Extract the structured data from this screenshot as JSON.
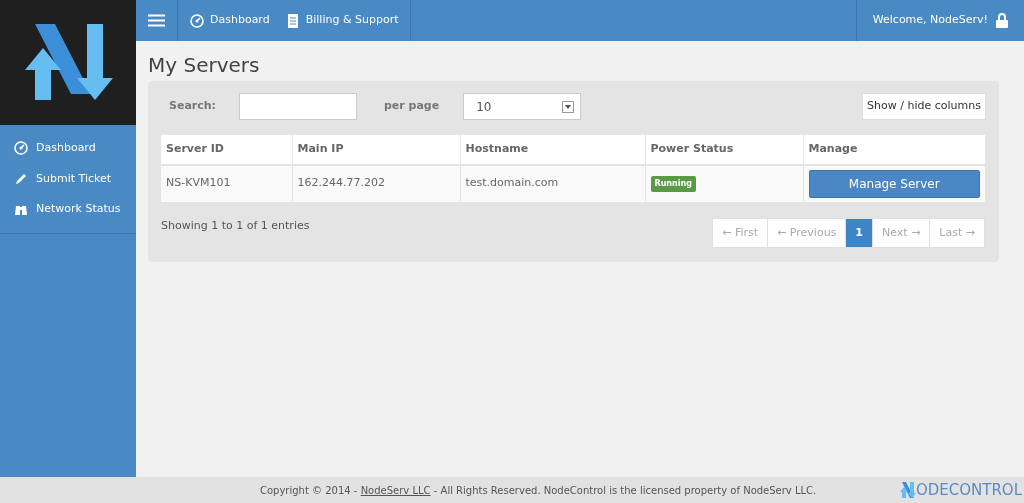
{
  "topbar": {
    "items": [
      {
        "label": "Dashboard"
      },
      {
        "label": "Billing & Support"
      }
    ],
    "welcome": "Welcome, NodeServ!"
  },
  "sidebar": {
    "items": [
      {
        "label": "Dashboard"
      },
      {
        "label": "Submit Ticket"
      },
      {
        "label": "Network Status"
      }
    ]
  },
  "page_title": "My Servers",
  "search": {
    "label": "Search:"
  },
  "per_page": {
    "label": "per page",
    "value": "10"
  },
  "columns_button": "Show / hide columns",
  "table": {
    "columns": [
      "Server ID",
      "Main IP",
      "Hostname",
      "Power Status",
      "Manage"
    ],
    "rows": [
      {
        "server_id": "NS-KVM101",
        "main_ip": "162.244.77.202",
        "hostname": "test.domain.com",
        "status": "Running",
        "action": "Manage Server"
      }
    ]
  },
  "info": "Showing 1 to 1 of 1 entries",
  "pagination": [
    {
      "label": "← First",
      "selected": false
    },
    {
      "label": "← Previous",
      "selected": false
    },
    {
      "label": "1",
      "selected": true
    },
    {
      "label": "Next →",
      "selected": false
    },
    {
      "label": "Last →",
      "selected": false
    }
  ],
  "footer": {
    "before": "Copyright © 2014 - ",
    "link": "NodeServ LLC",
    "after": " - All Rights Reserved. NodeControl is the licensed property of NodeServ LLC.",
    "logo_text": "ODECONTROL"
  }
}
